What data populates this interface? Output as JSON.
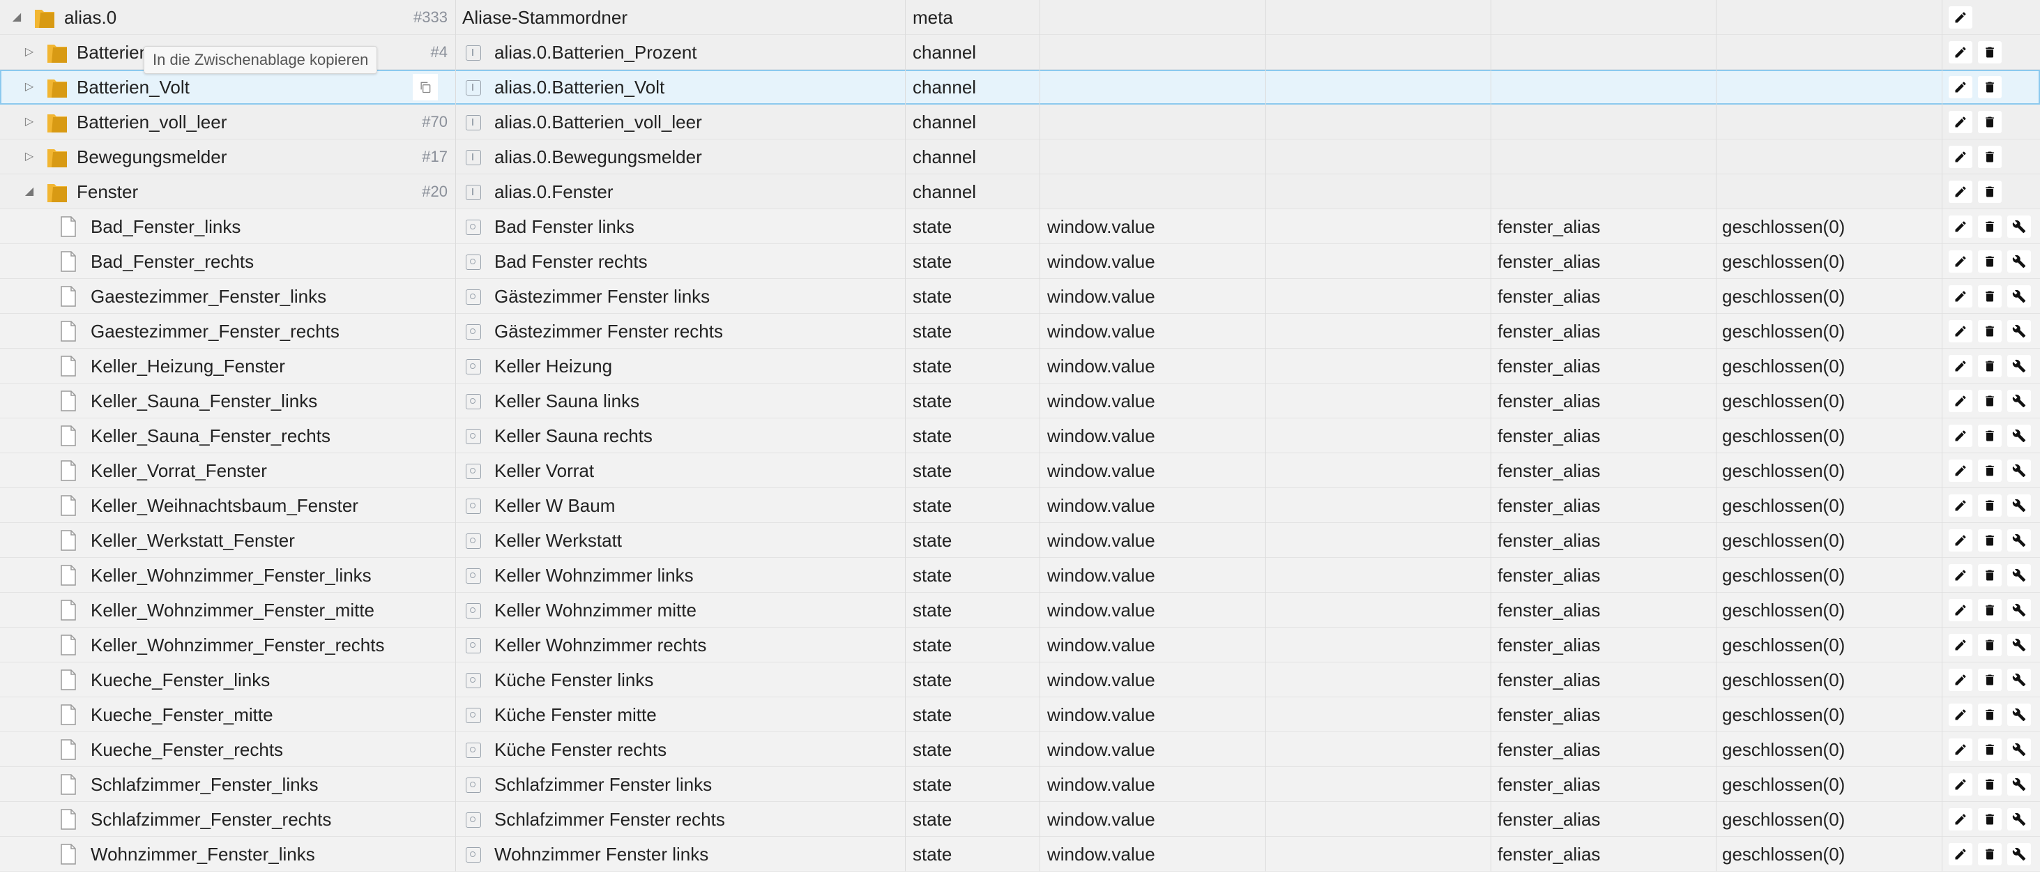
{
  "tooltip": "In die Zwischenablage kopieren",
  "rows": [
    {
      "level": 0,
      "expander": "open",
      "icon": "folder",
      "id_label": "alias.0",
      "obj_id": "#333",
      "name": "Aliase-Stammordner",
      "name_icon": "",
      "type": "meta",
      "role": "",
      "room": "",
      "function": "",
      "value": "",
      "buttons": [
        "edit"
      ],
      "selected": false
    },
    {
      "level": 1,
      "expander": "closed",
      "icon": "folder",
      "id_label": "Batterien_Prozent",
      "obj_id": "#4",
      "name": "alias.0.Batterien_Prozent",
      "name_icon": "channel",
      "type": "channel",
      "role": "",
      "room": "",
      "function": "",
      "value": "",
      "buttons": [
        "edit",
        "delete"
      ],
      "selected": false
    },
    {
      "level": 1,
      "expander": "closed",
      "icon": "folder",
      "id_label": "Batterien_Volt",
      "obj_id": "",
      "name": "alias.0.Batterien_Volt",
      "name_icon": "channel",
      "type": "channel",
      "role": "",
      "room": "",
      "function": "",
      "value": "",
      "buttons": [
        "edit",
        "delete"
      ],
      "selected": true
    },
    {
      "level": 1,
      "expander": "closed",
      "icon": "folder",
      "id_label": "Batterien_voll_leer",
      "obj_id": "#70",
      "name": "alias.0.Batterien_voll_leer",
      "name_icon": "channel",
      "type": "channel",
      "role": "",
      "room": "",
      "function": "",
      "value": "",
      "buttons": [
        "edit",
        "delete"
      ],
      "selected": false
    },
    {
      "level": 1,
      "expander": "closed",
      "icon": "folder",
      "id_label": "Bewegungsmelder",
      "obj_id": "#17",
      "name": "alias.0.Bewegungsmelder",
      "name_icon": "channel",
      "type": "channel",
      "role": "",
      "room": "",
      "function": "",
      "value": "",
      "buttons": [
        "edit",
        "delete"
      ],
      "selected": false
    },
    {
      "level": 1,
      "expander": "open",
      "icon": "folder",
      "id_label": "Fenster",
      "obj_id": "#20",
      "name": "alias.0.Fenster",
      "name_icon": "channel",
      "type": "channel",
      "role": "",
      "room": "",
      "function": "",
      "value": "",
      "buttons": [
        "edit",
        "delete"
      ],
      "selected": false
    },
    {
      "level": 2,
      "expander": "",
      "icon": "file",
      "id_label": "Bad_Fenster_links",
      "obj_id": "",
      "name": "Bad Fenster links",
      "name_icon": "state",
      "type": "state",
      "role": "window.value",
      "room": "",
      "function": "fenster_alias",
      "value": "geschlossen(0)",
      "buttons": [
        "edit",
        "delete",
        "settings"
      ],
      "selected": false
    },
    {
      "level": 2,
      "expander": "",
      "icon": "file",
      "id_label": "Bad_Fenster_rechts",
      "obj_id": "",
      "name": "Bad Fenster rechts",
      "name_icon": "state",
      "type": "state",
      "role": "window.value",
      "room": "",
      "function": "fenster_alias",
      "value": "geschlossen(0)",
      "buttons": [
        "edit",
        "delete",
        "settings"
      ],
      "selected": false
    },
    {
      "level": 2,
      "expander": "",
      "icon": "file",
      "id_label": "Gaestezimmer_Fenster_links",
      "obj_id": "",
      "name": "Gästezimmer Fenster links",
      "name_icon": "state",
      "type": "state",
      "role": "window.value",
      "room": "",
      "function": "fenster_alias",
      "value": "geschlossen(0)",
      "buttons": [
        "edit",
        "delete",
        "settings"
      ],
      "selected": false
    },
    {
      "level": 2,
      "expander": "",
      "icon": "file",
      "id_label": "Gaestezimmer_Fenster_rechts",
      "obj_id": "",
      "name": "Gästezimmer Fenster rechts",
      "name_icon": "state",
      "type": "state",
      "role": "window.value",
      "room": "",
      "function": "fenster_alias",
      "value": "geschlossen(0)",
      "buttons": [
        "edit",
        "delete",
        "settings"
      ],
      "selected": false
    },
    {
      "level": 2,
      "expander": "",
      "icon": "file",
      "id_label": "Keller_Heizung_Fenster",
      "obj_id": "",
      "name": "Keller Heizung",
      "name_icon": "state",
      "type": "state",
      "role": "window.value",
      "room": "",
      "function": "fenster_alias",
      "value": "geschlossen(0)",
      "buttons": [
        "edit",
        "delete",
        "settings"
      ],
      "selected": false
    },
    {
      "level": 2,
      "expander": "",
      "icon": "file",
      "id_label": "Keller_Sauna_Fenster_links",
      "obj_id": "",
      "name": "Keller Sauna links",
      "name_icon": "state",
      "type": "state",
      "role": "window.value",
      "room": "",
      "function": "fenster_alias",
      "value": "geschlossen(0)",
      "buttons": [
        "edit",
        "delete",
        "settings"
      ],
      "selected": false
    },
    {
      "level": 2,
      "expander": "",
      "icon": "file",
      "id_label": "Keller_Sauna_Fenster_rechts",
      "obj_id": "",
      "name": "Keller Sauna rechts",
      "name_icon": "state",
      "type": "state",
      "role": "window.value",
      "room": "",
      "function": "fenster_alias",
      "value": "geschlossen(0)",
      "buttons": [
        "edit",
        "delete",
        "settings"
      ],
      "selected": false
    },
    {
      "level": 2,
      "expander": "",
      "icon": "file",
      "id_label": "Keller_Vorrat_Fenster",
      "obj_id": "",
      "name": "Keller Vorrat",
      "name_icon": "state",
      "type": "state",
      "role": "window.value",
      "room": "",
      "function": "fenster_alias",
      "value": "geschlossen(0)",
      "buttons": [
        "edit",
        "delete",
        "settings"
      ],
      "selected": false
    },
    {
      "level": 2,
      "expander": "",
      "icon": "file",
      "id_label": "Keller_Weihnachtsbaum_Fenster",
      "obj_id": "",
      "name": "Keller W Baum",
      "name_icon": "state",
      "type": "state",
      "role": "window.value",
      "room": "",
      "function": "fenster_alias",
      "value": "geschlossen(0)",
      "buttons": [
        "edit",
        "delete",
        "settings"
      ],
      "selected": false
    },
    {
      "level": 2,
      "expander": "",
      "icon": "file",
      "id_label": "Keller_Werkstatt_Fenster",
      "obj_id": "",
      "name": "Keller Werkstatt",
      "name_icon": "state",
      "type": "state",
      "role": "window.value",
      "room": "",
      "function": "fenster_alias",
      "value": "geschlossen(0)",
      "buttons": [
        "edit",
        "delete",
        "settings"
      ],
      "selected": false
    },
    {
      "level": 2,
      "expander": "",
      "icon": "file",
      "id_label": "Keller_Wohnzimmer_Fenster_links",
      "obj_id": "",
      "name": "Keller Wohnzimmer links",
      "name_icon": "state",
      "type": "state",
      "role": "window.value",
      "room": "",
      "function": "fenster_alias",
      "value": "geschlossen(0)",
      "buttons": [
        "edit",
        "delete",
        "settings"
      ],
      "selected": false
    },
    {
      "level": 2,
      "expander": "",
      "icon": "file",
      "id_label": "Keller_Wohnzimmer_Fenster_mitte",
      "obj_id": "",
      "name": "Keller Wohnzimmer mitte",
      "name_icon": "state",
      "type": "state",
      "role": "window.value",
      "room": "",
      "function": "fenster_alias",
      "value": "geschlossen(0)",
      "buttons": [
        "edit",
        "delete",
        "settings"
      ],
      "selected": false
    },
    {
      "level": 2,
      "expander": "",
      "icon": "file",
      "id_label": "Keller_Wohnzimmer_Fenster_rechts",
      "obj_id": "",
      "name": "Keller Wohnzimmer rechts",
      "name_icon": "state",
      "type": "state",
      "role": "window.value",
      "room": "",
      "function": "fenster_alias",
      "value": "geschlossen(0)",
      "buttons": [
        "edit",
        "delete",
        "settings"
      ],
      "selected": false
    },
    {
      "level": 2,
      "expander": "",
      "icon": "file",
      "id_label": "Kueche_Fenster_links",
      "obj_id": "",
      "name": "Küche Fenster links",
      "name_icon": "state",
      "type": "state",
      "role": "window.value",
      "room": "",
      "function": "fenster_alias",
      "value": "geschlossen(0)",
      "buttons": [
        "edit",
        "delete",
        "settings"
      ],
      "selected": false
    },
    {
      "level": 2,
      "expander": "",
      "icon": "file",
      "id_label": "Kueche_Fenster_mitte",
      "obj_id": "",
      "name": "Küche Fenster mitte",
      "name_icon": "state",
      "type": "state",
      "role": "window.value",
      "room": "",
      "function": "fenster_alias",
      "value": "geschlossen(0)",
      "buttons": [
        "edit",
        "delete",
        "settings"
      ],
      "selected": false
    },
    {
      "level": 2,
      "expander": "",
      "icon": "file",
      "id_label": "Kueche_Fenster_rechts",
      "obj_id": "",
      "name": "Küche Fenster rechts",
      "name_icon": "state",
      "type": "state",
      "role": "window.value",
      "room": "",
      "function": "fenster_alias",
      "value": "geschlossen(0)",
      "buttons": [
        "edit",
        "delete",
        "settings"
      ],
      "selected": false
    },
    {
      "level": 2,
      "expander": "",
      "icon": "file",
      "id_label": "Schlafzimmer_Fenster_links",
      "obj_id": "",
      "name": "Schlafzimmer Fenster links",
      "name_icon": "state",
      "type": "state",
      "role": "window.value",
      "room": "",
      "function": "fenster_alias",
      "value": "geschlossen(0)",
      "buttons": [
        "edit",
        "delete",
        "settings"
      ],
      "selected": false
    },
    {
      "level": 2,
      "expander": "",
      "icon": "file",
      "id_label": "Schlafzimmer_Fenster_rechts",
      "obj_id": "",
      "name": "Schlafzimmer Fenster rechts",
      "name_icon": "state",
      "type": "state",
      "role": "window.value",
      "room": "",
      "function": "fenster_alias",
      "value": "geschlossen(0)",
      "buttons": [
        "edit",
        "delete",
        "settings"
      ],
      "selected": false
    },
    {
      "level": 2,
      "expander": "",
      "icon": "file",
      "id_label": "Wohnzimmer_Fenster_links",
      "obj_id": "",
      "name": "Wohnzimmer Fenster links",
      "name_icon": "state",
      "type": "state",
      "role": "window.value",
      "room": "",
      "function": "fenster_alias",
      "value": "geschlossen(0)",
      "buttons": [
        "edit",
        "delete",
        "settings"
      ],
      "selected": false
    }
  ],
  "colors": {
    "folder": "#f2b632",
    "selected_row": "#e6f3fb",
    "selected_border": "#8cc9ee",
    "id_number": "#8a8f99"
  }
}
